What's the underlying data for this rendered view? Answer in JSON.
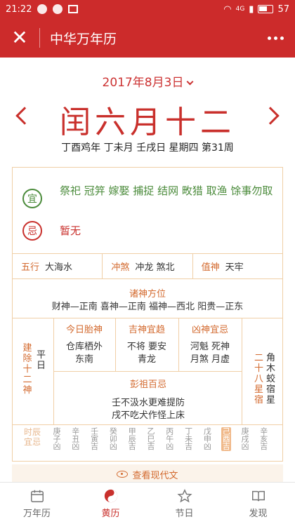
{
  "status": {
    "time": "21:22",
    "signal": "4G",
    "battery": "57"
  },
  "header": {
    "title": "中华万年历"
  },
  "date_selector": "2017年8月3日",
  "lunar_date": "闰六月十二",
  "ganzhi": "丁酉鸡年 丁未月 壬戌日 星期四 第31周",
  "yi": {
    "seal": "宜",
    "text": "祭祀 冠笄 嫁娶 捕捉 结网 畋猎 取渔 馀事勿取"
  },
  "ji": {
    "seal": "忌",
    "text": "暂无"
  },
  "wuxing": {
    "label": "五行",
    "value": "大海水"
  },
  "chongsha": {
    "label": "冲煞",
    "value": "冲龙 煞北"
  },
  "zhishen": {
    "label": "值神",
    "value": "天牢"
  },
  "zhushen": {
    "title": "诸神方位",
    "text": "财神—正南 喜神—正南 福神—西北 阳贵—正东"
  },
  "jianchu": {
    "label": "建除十二神",
    "value": "平日"
  },
  "taishen": {
    "title": "今日胎神",
    "lines": [
      "仓库栖外",
      "东南"
    ]
  },
  "jishen": {
    "title": "吉神宜趋",
    "lines": [
      "不将 要安",
      "青龙"
    ]
  },
  "xiongshen": {
    "title": "凶神宜忌",
    "lines": [
      "河魁 死神",
      "月煞 月虚"
    ]
  },
  "pengzu": {
    "title": "彭祖百忌",
    "lines": [
      "壬不汲水更难提防",
      "戌不吃犬作怪上床"
    ]
  },
  "xiu": {
    "label": "二十八星宿",
    "value": "角木蛟宿星"
  },
  "hours": {
    "label": "时辰宜忌",
    "items": [
      {
        "gz": "庚子",
        "j": "凶"
      },
      {
        "gz": "辛丑",
        "j": "凶"
      },
      {
        "gz": "壬寅",
        "j": "吉"
      },
      {
        "gz": "癸卯",
        "j": "凶"
      },
      {
        "gz": "甲辰",
        "j": "吉"
      },
      {
        "gz": "乙巳",
        "j": "吉"
      },
      {
        "gz": "丙午",
        "j": "凶"
      },
      {
        "gz": "丁未",
        "j": "吉"
      },
      {
        "gz": "戊申",
        "j": "凶"
      },
      {
        "gz": "己酉",
        "j": "吉"
      },
      {
        "gz": "庚戌",
        "j": "凶"
      },
      {
        "gz": "辛亥",
        "j": "吉"
      }
    ]
  },
  "modern_link": "查看现代文",
  "tabs": [
    {
      "label": "万年历"
    },
    {
      "label": "黄历"
    },
    {
      "label": "节日"
    },
    {
      "label": "发现"
    }
  ],
  "colors": {
    "brand": "#cc2b2b",
    "accent": "#d36a2f",
    "green": "#4b8b3b"
  }
}
